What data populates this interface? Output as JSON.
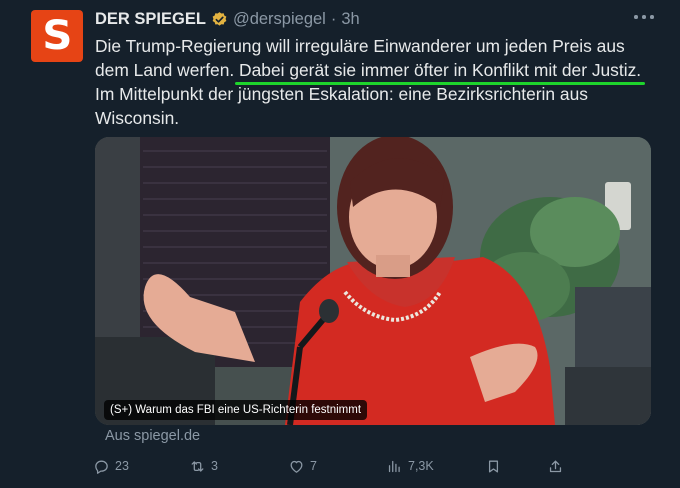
{
  "tweet": {
    "author_name": "DER SPIEGEL",
    "avatar_letter": "S",
    "handle": "@derspiegel",
    "separator": "·",
    "time": "3h",
    "text_line1": "Die Trump-Regierung will irreguläre Einwanderer um jeden Preis aus",
    "text_line2_a": "dem Land werfen. ",
    "text_line2_highlight": "Dabei gerät sie immer öfter in Konflikt mit der Justiz.",
    "text_line3": "Im Mittelpunkt der jüngsten Eskalation: eine Bezirksrichterin aus",
    "text_line4": "Wisconsin."
  },
  "media": {
    "caption": "(S+) Warum das FBI eine US-Richterin festnimmt",
    "source": "Aus spiegel.de"
  },
  "actions": {
    "replies": "23",
    "reposts": "3",
    "likes": "7",
    "views": "7,3K"
  },
  "colors": {
    "background": "#15202b",
    "brand": "#e64415",
    "highlight_underline": "#1ed42c",
    "muted_text": "#8b98a5",
    "verified_badge": "#e3b341"
  },
  "icons": [
    "more-icon",
    "verified-icon",
    "reply-icon",
    "repost-icon",
    "like-icon",
    "views-icon",
    "bookmark-icon",
    "share-icon"
  ]
}
